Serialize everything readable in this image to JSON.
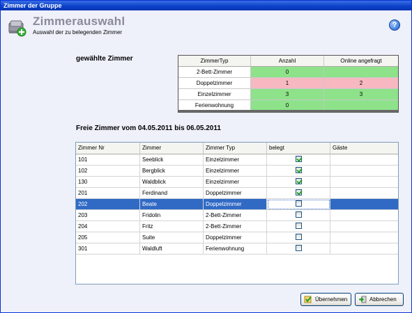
{
  "window": {
    "title": "Zimmer der Gruppe"
  },
  "header": {
    "title": "Zimmerauswahl",
    "subtitle": "Auswahl der zu belegenden Zimmer",
    "icon": "add-room-icon",
    "help_icon": "help-icon"
  },
  "summary": {
    "label": "gewählte Zimmer",
    "columns": [
      "ZimmerTyp",
      "Anzahl",
      "Online angefragt"
    ],
    "rows": [
      {
        "type": "2-Bett-Zimmer",
        "anzahl": "0",
        "online": "",
        "status": "green"
      },
      {
        "type": "Doppelzimmer",
        "anzahl": "1",
        "online": "2",
        "status": "pink"
      },
      {
        "type": "Einzelzimmer",
        "anzahl": "3",
        "online": "3",
        "status": "green"
      },
      {
        "type": "Ferienwohnung",
        "anzahl": "0",
        "online": "",
        "status": "green"
      }
    ]
  },
  "rooms": {
    "label": "Freie Zimmer vom 04.05.2011 bis 06.05.2011",
    "columns": [
      "Zimmer Nr",
      "Zimmer",
      "Zimmer Typ",
      "belegt",
      "Gäste"
    ],
    "rows": [
      {
        "nr": "101",
        "name": "Seeblick",
        "typ": "Einzelzimmer",
        "belegt": true,
        "gaeste": ""
      },
      {
        "nr": "102",
        "name": "Bergblick",
        "typ": "Einzelzimmer",
        "belegt": true,
        "gaeste": ""
      },
      {
        "nr": "130",
        "name": "Waldblick",
        "typ": "Einzelzimmer",
        "belegt": true,
        "gaeste": ""
      },
      {
        "nr": "201",
        "name": "Ferdinand",
        "typ": "Doppelzimmer",
        "belegt": true,
        "gaeste": ""
      },
      {
        "nr": "202",
        "name": "Beate",
        "typ": "Doppelzimmer",
        "belegt": false,
        "gaeste": "",
        "selected": true
      },
      {
        "nr": "203",
        "name": "Fridolin",
        "typ": "2-Bett-Zimmer",
        "belegt": false,
        "gaeste": ""
      },
      {
        "nr": "204",
        "name": "Fritz",
        "typ": "2-Bett-Zimmer",
        "belegt": false,
        "gaeste": ""
      },
      {
        "nr": "205",
        "name": "Suite",
        "typ": "Doppelzimmer",
        "belegt": false,
        "gaeste": ""
      },
      {
        "nr": "301",
        "name": "Waldluft",
        "typ": "Ferienwohnung",
        "belegt": false,
        "gaeste": ""
      }
    ]
  },
  "buttons": {
    "apply": "Übernehmen",
    "cancel": "Abbrechen"
  },
  "colors": {
    "title_bar": "#0a3fc8",
    "selected_row": "#316ac5",
    "status_green": "#8ee28a",
    "status_pink": "#f7b8c2"
  }
}
